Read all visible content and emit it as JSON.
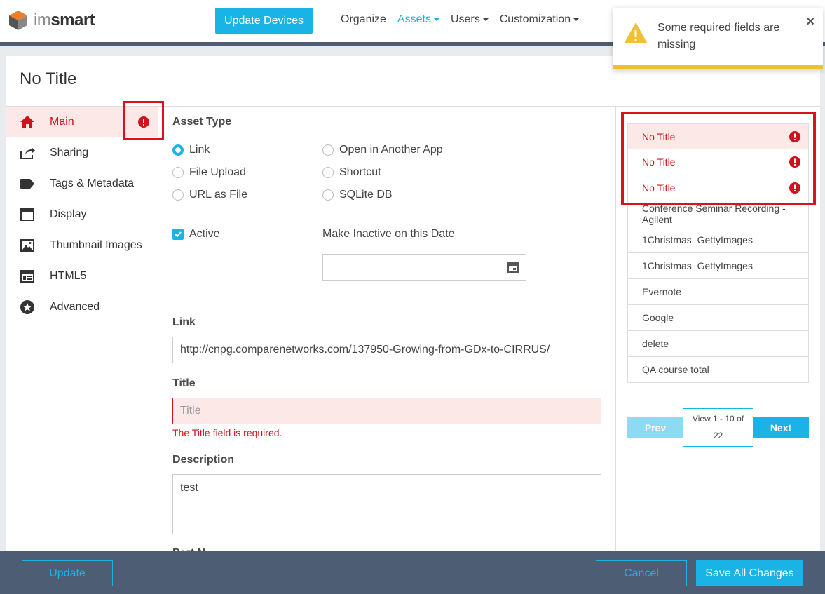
{
  "brand": {
    "light": "im",
    "bold": "smart"
  },
  "header": {
    "update_devices": "Update Devices",
    "nav": [
      {
        "label": "Organize",
        "dropdown": false,
        "active": false
      },
      {
        "label": "Assets",
        "dropdown": true,
        "active": true
      },
      {
        "label": "Users",
        "dropdown": true,
        "active": false
      },
      {
        "label": "Customization",
        "dropdown": true,
        "active": false
      }
    ]
  },
  "toast": {
    "message": "Some required fields are missing",
    "close": "×",
    "icon": "warning-icon"
  },
  "page": {
    "title": "No Title"
  },
  "sidebar": {
    "items": [
      {
        "label": "Main",
        "icon": "home-icon",
        "active": true
      },
      {
        "label": "Sharing",
        "icon": "share-icon"
      },
      {
        "label": "Tags & Metadata",
        "icon": "tag-icon"
      },
      {
        "label": "Display",
        "icon": "window-icon"
      },
      {
        "label": "Thumbnail Images",
        "icon": "image-icon"
      },
      {
        "label": "HTML5",
        "icon": "html5-icon"
      },
      {
        "label": "Advanced",
        "icon": "star-icon"
      }
    ]
  },
  "form": {
    "asset_type_label": "Asset Type",
    "asset_types": [
      "Link",
      "Open in Another App",
      "File Upload",
      "Shortcut",
      "URL as File",
      "SQLite DB"
    ],
    "selected_asset_type": "Link",
    "active_label": "Active",
    "active_checked": true,
    "inactive_date_label": "Make Inactive on this Date",
    "inactive_date_value": "",
    "link_label": "Link",
    "link_value": "http://cnpg.comparenetworks.com/137950-Growing-from-GDx-to-CIRRUS/",
    "title_label": "Title",
    "title_placeholder": "Title",
    "title_error": "The Title field is required.",
    "description_label": "Description",
    "description_value": "test",
    "next_label_partial": "Part N"
  },
  "asset_list": {
    "items": [
      {
        "label": "No Title",
        "error": true
      },
      {
        "label": "No Title",
        "error": true
      },
      {
        "label": "No Title",
        "error": true
      },
      {
        "label": "Conference Seminar Recording - Agilent",
        "error": false
      },
      {
        "label": "1Christmas_GettyImages",
        "error": false
      },
      {
        "label": "1Christmas_GettyImages",
        "error": false
      },
      {
        "label": "Evernote",
        "error": false
      },
      {
        "label": "Google",
        "error": false
      },
      {
        "label": "delete",
        "error": false
      },
      {
        "label": "QA course total",
        "error": false
      }
    ],
    "pager": {
      "prev": "Prev",
      "info_line1": "View 1 - 10 of",
      "info_line2": "22",
      "next": "Next"
    }
  },
  "footer": {
    "update": "Update",
    "cancel": "Cancel",
    "save_all": "Save All Changes"
  },
  "colors": {
    "accent": "#1ab3e6",
    "error": "#d0121b",
    "warning": "#f0c030",
    "nav_dark": "#4d5d73"
  }
}
